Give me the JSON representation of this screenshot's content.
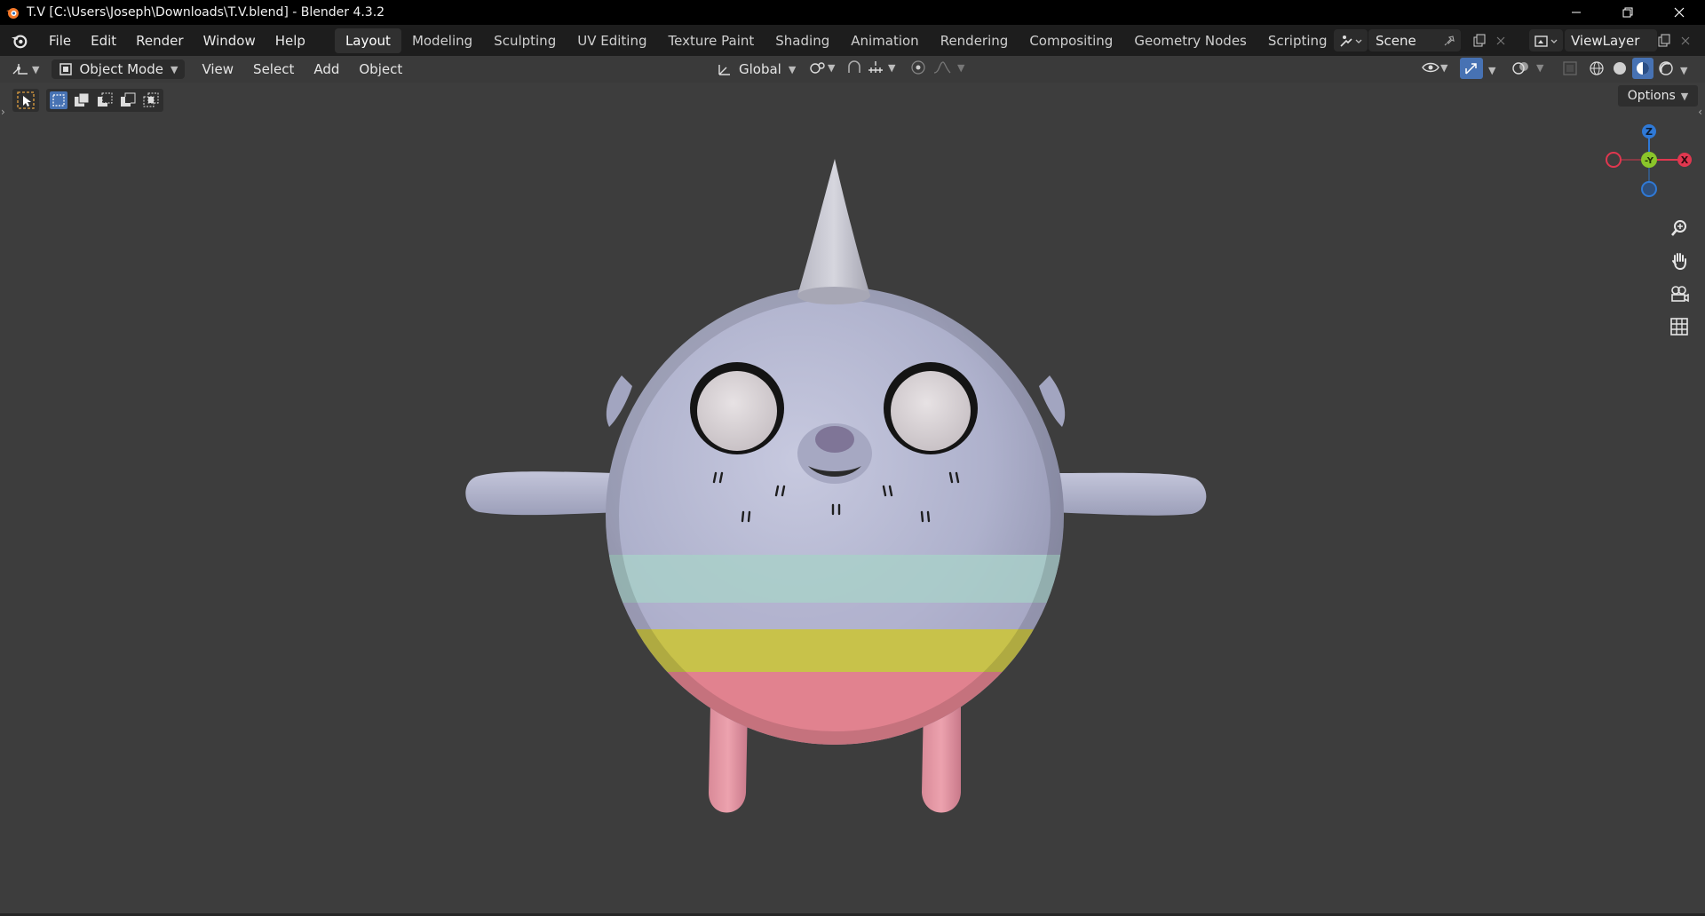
{
  "window": {
    "title": "T.V [C:\\Users\\Joseph\\Downloads\\T.V.blend] - Blender 4.3.2",
    "minimize_icon": "minimize-icon",
    "restore_icon": "restore-icon",
    "close_icon": "close-icon"
  },
  "menubar": {
    "menus": [
      "File",
      "Edit",
      "Render",
      "Window",
      "Help"
    ],
    "workspace_tabs": [
      "Layout",
      "Modeling",
      "Sculpting",
      "UV Editing",
      "Texture Paint",
      "Shading",
      "Animation",
      "Rendering",
      "Compositing",
      "Geometry Nodes",
      "Scripting"
    ],
    "active_tab": "Layout",
    "add_tab": "+",
    "scene": "Scene",
    "view_layer": "ViewLayer"
  },
  "viewport_header": {
    "mode": "Object Mode",
    "menus": [
      "View",
      "Select",
      "Add",
      "Object"
    ],
    "transform_orientation": "Global",
    "options_label": "Options"
  },
  "gizmo": {
    "z": "Z",
    "y": "-Y",
    "x": "X"
  },
  "colors": {
    "accent": "#4772b3",
    "axis_x": "#e0374f",
    "axis_y": "#8bc52a",
    "axis_z": "#2f79d6",
    "background": "#3d3d3d"
  }
}
